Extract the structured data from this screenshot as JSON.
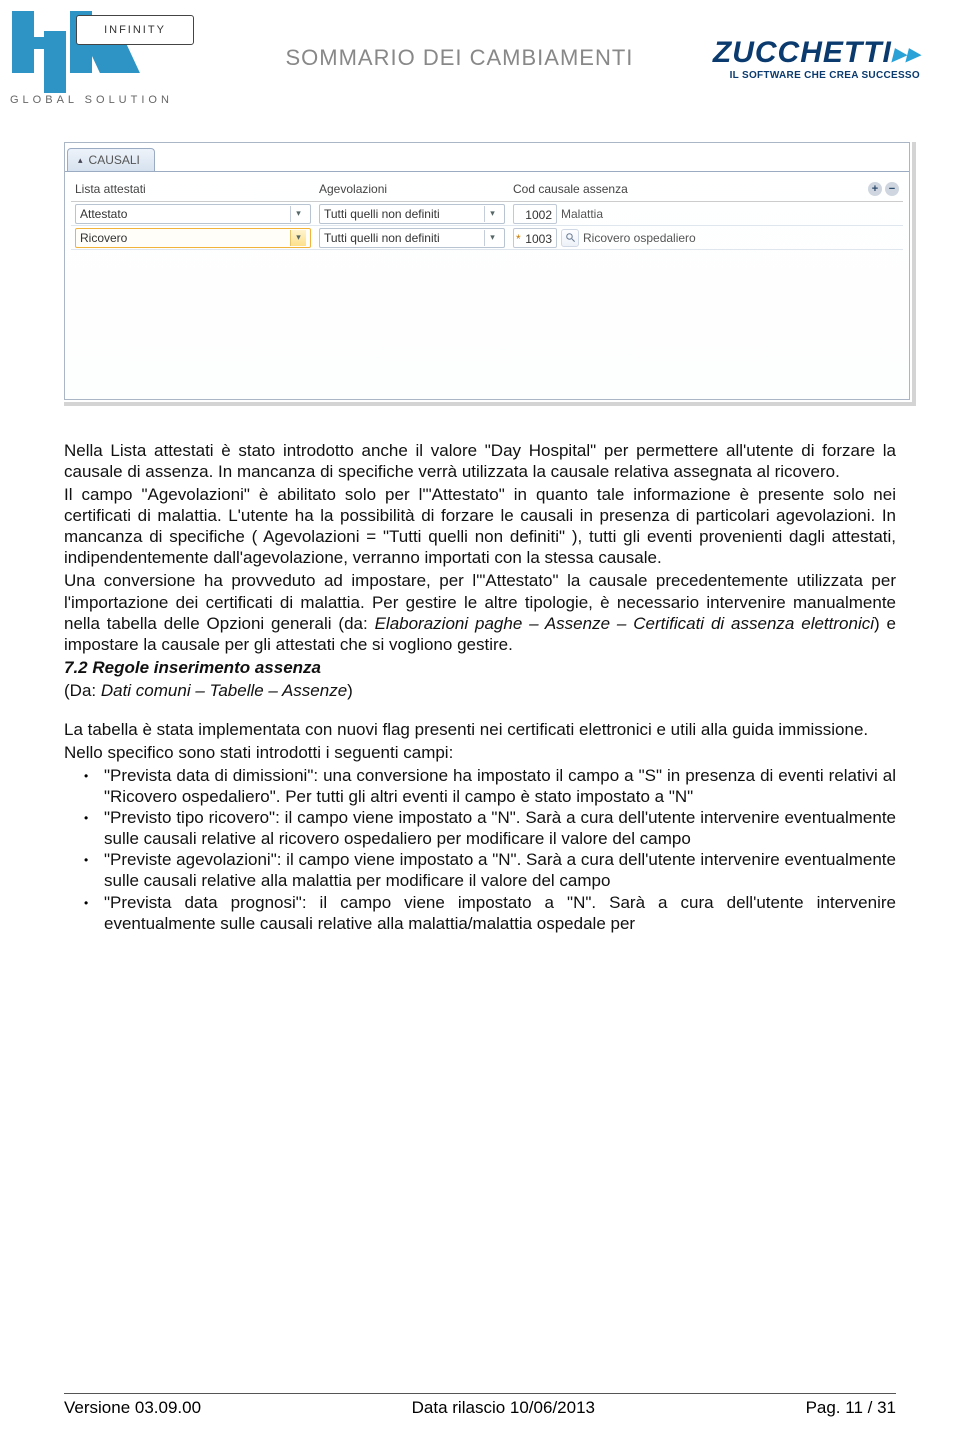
{
  "header": {
    "left_logo_infinity": "INFINITY",
    "left_logo_tag": "GLOBAL SOLUTION",
    "doc_title": "SOMMARIO DEI CAMBIAMENTI",
    "right_logo_name": "ZUCCHETTI",
    "right_logo_tag": "IL SOFTWARE CHE CREA SUCCESSO"
  },
  "screenshot": {
    "tab_label": "CAUSALI",
    "columns": {
      "a": "Lista attestati",
      "b": "Agevolazioni",
      "c": "Cod causale assenza"
    },
    "rows": [
      {
        "lista": "Attestato",
        "agev": "Tutti quelli non definiti",
        "code": "1002",
        "desc": "Malattia",
        "selected": false,
        "star": false,
        "mag": false
      },
      {
        "lista": "Ricovero",
        "agev": "Tutti quelli non definiti",
        "code": "1003",
        "desc": "Ricovero ospedaliero",
        "selected": true,
        "star": true,
        "mag": true
      }
    ]
  },
  "body": {
    "p1": "Nella Lista attestati è stato introdotto anche il valore \"Day Hospital\" per permettere all'utente di forzare la causale di assenza. In mancanza di specifiche verrà utilizzata la causale relativa assegnata al ricovero.",
    "p2a": "Il campo \"Agevolazioni\" è abilitato solo per l'\"Attestato\" in quanto tale informazione è presente solo nei certificati di malattia. L'utente ha la possibilità di forzare le causali in presenza di particolari agevolazioni. In mancanza di specifiche ( Agevolazioni = \"Tutti quelli non definiti\" ), tutti gli eventi provenienti dagli attestati, indipendentemente dall'agevolazione, verranno importati con la stessa causale.",
    "p3a": "Una conversione ha provveduto ad impostare, per l'\"Attestato\" la causale precedentemente utilizzata per l'importazione dei certificati di malattia. Per gestire le altre tipologie, è necessario intervenire manualmente nella tabella delle Opzioni generali (da: ",
    "p3b_em": "Elaborazioni paghe – Assenze – Certificati di assenza elettronici",
    "p3c": ") e impostare la causale per gli attestati che si vogliono gestire.",
    "h2": "7.2 Regole inserimento assenza",
    "da_open": "(Da: ",
    "da_em": "Dati comuni – Tabelle – Assenze",
    "da_close": ")",
    "p4": "La tabella è stata implementata con nuovi flag presenti nei certificati elettronici e utili alla guida immissione.",
    "p5": "Nello specifico sono stati introdotti i seguenti campi:",
    "bullets": [
      "\"Prevista data di dimissioni\": una conversione ha impostato il campo a \"S\" in presenza di eventi relativi al \"Ricovero ospedaliero\". Per tutti gli altri eventi il campo è stato impostato a \"N\"",
      "\"Previsto tipo ricovero\": il campo viene impostato a \"N\". Sarà a cura dell'utente intervenire eventualmente sulle causali relative al ricovero ospedaliero per modificare il valore del campo",
      "\"Previste agevolazioni\": il campo viene impostato a \"N\". Sarà a cura dell'utente intervenire eventualmente sulle causali relative alla malattia per modificare il valore del campo",
      "\"Prevista data prognosi\": il campo viene impostato a \"N\". Sarà a cura dell'utente intervenire eventualmente sulle causali relative alla malattia/malattia ospedale per"
    ]
  },
  "footer": {
    "version": "Versione 03.09.00",
    "date": "Data rilascio 10/06/2013",
    "page": "Pag. 11 / 31"
  }
}
